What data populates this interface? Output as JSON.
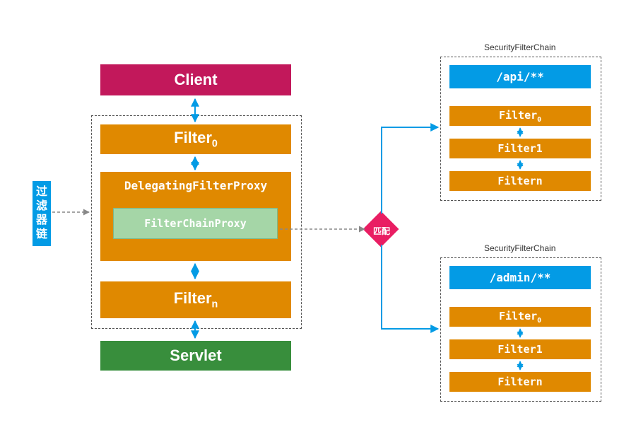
{
  "client": "Client",
  "servlet": "Servlet",
  "sidebar": [
    "过",
    "滤",
    "器",
    "链"
  ],
  "filterChain": {
    "filter0": "Filter",
    "filter0_sub": "0",
    "filterN": "Filter",
    "filterN_sub": "n",
    "delegating": "DelegatingFilterProxy",
    "chainProxy": "FilterChainProxy"
  },
  "match": "匹配",
  "chains": [
    {
      "title": "SecurityFilterChain",
      "pattern": "/api/**",
      "filters": [
        "Filter",
        "Filter1",
        "Filtern"
      ],
      "filter0_sub": "0"
    },
    {
      "title": "SecurityFilterChain",
      "pattern": "/admin/**",
      "filters": [
        "Filter",
        "Filter1",
        "Filtern"
      ],
      "filter0_sub": "0"
    }
  ]
}
